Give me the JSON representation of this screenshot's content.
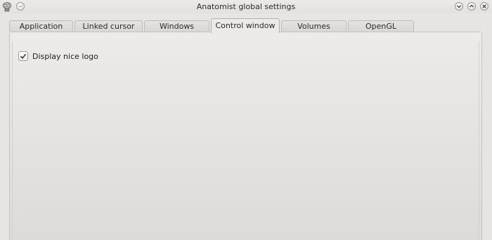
{
  "window": {
    "title": "Anatomist global settings",
    "app_icon": "anatomist-brain-icon"
  },
  "titlebar_buttons": {
    "menu": "window-menu-icon",
    "minimize": "chevron-down-icon",
    "maximize": "chevron-up-icon",
    "close": "close-icon"
  },
  "tabs": [
    {
      "label": "Application",
      "active": false
    },
    {
      "label": "Linked cursor",
      "active": false
    },
    {
      "label": "Windows",
      "active": false
    },
    {
      "label": "Control window",
      "active": true
    },
    {
      "label": "Volumes",
      "active": false
    },
    {
      "label": "OpenGL",
      "active": false
    }
  ],
  "control_window": {
    "display_logo": {
      "label": "Display nice logo",
      "checked": true
    }
  }
}
